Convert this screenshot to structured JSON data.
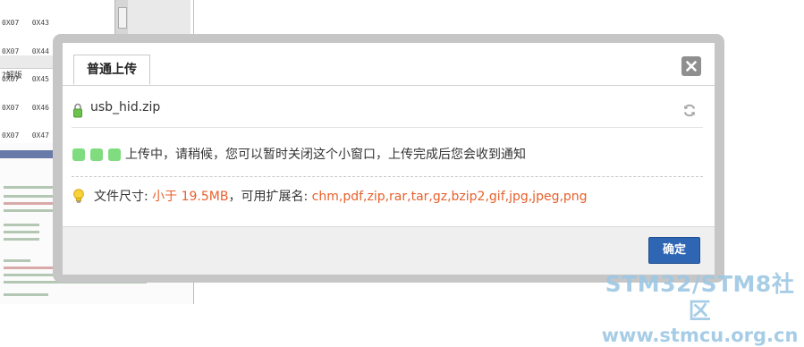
{
  "background": {
    "hex_rows": [
      "0X07   0X43",
      "0X07   0X44",
      "0X07   0X45",
      "0X07   0X46",
      "0X07   0X47"
    ],
    "toolbar_label": "?解版"
  },
  "dialog": {
    "tab_label": "普通上传",
    "file_name": "usb_hid.zip",
    "status_text": "上传中，请稍候，您可以暂时关闭这个小窗口，上传完成后您会收到通知",
    "size_label": "文件尺寸: ",
    "size_value": "小于 19.5MB",
    "ext_label": "，可用扩展名: ",
    "ext_value": "chm,pdf,zip,rar,tar,gz,bzip2,gif,jpg,jpeg,png",
    "ok_label": "确定"
  },
  "icons": {
    "close": "close-icon",
    "file": "lock-icon",
    "refresh": "refresh-icon",
    "info": "bulb-icon"
  },
  "colors": {
    "accent_button": "#2f66b3",
    "highlight_text": "#e8602c",
    "progress_dot": "#7fdc7f"
  },
  "watermark": {
    "line1": "STM32/STM8社区",
    "line2": "www.stmcu.org.cn"
  }
}
